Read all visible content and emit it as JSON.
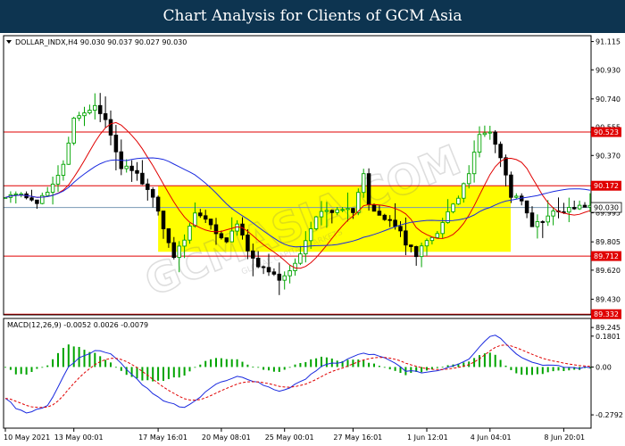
{
  "banner": {
    "title": "Chart Analysis for Clients of GCM Asia"
  },
  "watermark": {
    "text": "GCMASIA.COM",
    "subtext": "GLOBAL CAPITAL MARKETS"
  },
  "chart_data": [
    {
      "type": "candlestick",
      "symbol_header": "DOLLAR_INDX,H4  90.030 90.037 90.027 90.030",
      "ylim": [
        89.24,
        91.13
      ],
      "yticks": [
        "91.115",
        "90.930",
        "90.740",
        "90.555",
        "90.370",
        "90.185",
        "89.995",
        "89.805",
        "89.620",
        "89.430",
        "89.245"
      ],
      "xticks": [
        "10 May 2021",
        "13 May 00:01",
        "17 May 16:01",
        "20 May 08:01",
        "25 May 00:01",
        "27 May 16:01",
        "1 Jun 12:01",
        "4 Jun 04:01",
        "8 Jun 20:01"
      ],
      "xtick_index": [
        0,
        13,
        29,
        41,
        53,
        66,
        80,
        92,
        106
      ],
      "bar_count": 112,
      "levels": [
        {
          "value": 90.523,
          "label": "90.523",
          "color": "#e00000"
        },
        {
          "value": 90.172,
          "label": "90.172",
          "color": "#e00000"
        },
        {
          "value": 89.712,
          "label": "89.712",
          "color": "#e00000"
        },
        {
          "value": 89.332,
          "label": "89.332",
          "color": "#e00000"
        }
      ],
      "current_price": {
        "value": 90.03,
        "label": "90.030",
        "color": "#7a98b4"
      },
      "zone": {
        "from_index": 29,
        "to_index": 118,
        "low": 89.74,
        "high": 90.17,
        "color": "#ffff00"
      },
      "candle_colors": {
        "up": "#00a400",
        "down": "#000000"
      },
      "close_anchors": [
        [
          0,
          90.1
        ],
        [
          3,
          90.12
        ],
        [
          6,
          90.05
        ],
        [
          9,
          90.18
        ],
        [
          11,
          90.3
        ],
        [
          13,
          90.62
        ],
        [
          15,
          90.65
        ],
        [
          17,
          90.7
        ],
        [
          19,
          90.6
        ],
        [
          22,
          90.3
        ],
        [
          25,
          90.25
        ],
        [
          28,
          90.1
        ],
        [
          30,
          89.9
        ],
        [
          32,
          89.7
        ],
        [
          34,
          89.82
        ],
        [
          36,
          90.0
        ],
        [
          38,
          89.95
        ],
        [
          40,
          89.86
        ],
        [
          42,
          89.8
        ],
        [
          44,
          89.92
        ],
        [
          46,
          89.75
        ],
        [
          48,
          89.65
        ],
        [
          50,
          89.62
        ],
        [
          52,
          89.55
        ],
        [
          54,
          89.62
        ],
        [
          56,
          89.72
        ],
        [
          58,
          89.9
        ],
        [
          60,
          90.02
        ],
        [
          62,
          90.0
        ],
        [
          64,
          90.02
        ],
        [
          66,
          90.0
        ],
        [
          68,
          90.25
        ],
        [
          69,
          90.05
        ],
        [
          72,
          89.95
        ],
        [
          74,
          89.92
        ],
        [
          76,
          89.8
        ],
        [
          78,
          89.72
        ],
        [
          80,
          89.82
        ],
        [
          82,
          89.86
        ],
        [
          84,
          90.0
        ],
        [
          86,
          90.1
        ],
        [
          88,
          90.25
        ],
        [
          90,
          90.5
        ],
        [
          92,
          90.53
        ],
        [
          94,
          90.35
        ],
        [
          96,
          90.1
        ],
        [
          98,
          90.08
        ],
        [
          100,
          89.9
        ],
        [
          102,
          89.95
        ],
        [
          104,
          90.0
        ],
        [
          106,
          90.01
        ],
        [
          108,
          90.03
        ],
        [
          111,
          90.03
        ]
      ],
      "series": [
        {
          "name": "fast moving average",
          "color": "#e00000",
          "period": 10
        },
        {
          "name": "slow moving average",
          "color": "#1a2adf",
          "period": 24
        }
      ]
    },
    {
      "type": "macd",
      "title": "MACD(12,26,9) -0.0052 0.0026 -0.0079",
      "ylim": [
        -0.31,
        0.2
      ],
      "yticks": [
        "0.1801",
        "0.00",
        "-0.2792"
      ],
      "colors": {
        "histogram": "#00a400",
        "macd": "#1a2adf",
        "signal": "#e00000"
      },
      "macd_anchors": [
        [
          0,
          -0.18
        ],
        [
          2,
          -0.24
        ],
        [
          4,
          -0.27
        ],
        [
          6,
          -0.25
        ],
        [
          8,
          -0.22
        ],
        [
          10,
          -0.12
        ],
        [
          12,
          0.0
        ],
        [
          14,
          0.06
        ],
        [
          16,
          0.08
        ],
        [
          18,
          0.1
        ],
        [
          20,
          0.08
        ],
        [
          22,
          0.02
        ],
        [
          24,
          -0.04
        ],
        [
          26,
          -0.1
        ],
        [
          28,
          -0.15
        ],
        [
          30,
          -0.2
        ],
        [
          32,
          -0.22
        ],
        [
          34,
          -0.24
        ],
        [
          36,
          -0.2
        ],
        [
          38,
          -0.14
        ],
        [
          40,
          -0.1
        ],
        [
          42,
          -0.08
        ],
        [
          44,
          -0.06
        ],
        [
          46,
          -0.07
        ],
        [
          48,
          -0.09
        ],
        [
          50,
          -0.12
        ],
        [
          52,
          -0.14
        ],
        [
          54,
          -0.12
        ],
        [
          56,
          -0.09
        ],
        [
          58,
          -0.04
        ],
        [
          60,
          0.0
        ],
        [
          62,
          0.02
        ],
        [
          64,
          0.03
        ],
        [
          66,
          0.06
        ],
        [
          68,
          0.08
        ],
        [
          70,
          0.07
        ],
        [
          72,
          0.05
        ],
        [
          74,
          0.02
        ],
        [
          76,
          -0.02
        ],
        [
          78,
          -0.03
        ],
        [
          80,
          -0.03
        ],
        [
          82,
          -0.02
        ],
        [
          84,
          0.0
        ],
        [
          86,
          0.02
        ],
        [
          88,
          0.05
        ],
        [
          90,
          0.12
        ],
        [
          92,
          0.18
        ],
        [
          93,
          0.19
        ],
        [
          95,
          0.14
        ],
        [
          97,
          0.08
        ],
        [
          99,
          0.04
        ],
        [
          101,
          0.02
        ],
        [
          103,
          0.01
        ],
        [
          106,
          0.0
        ],
        [
          108,
          -0.005
        ],
        [
          111,
          -0.005
        ]
      ]
    }
  ]
}
